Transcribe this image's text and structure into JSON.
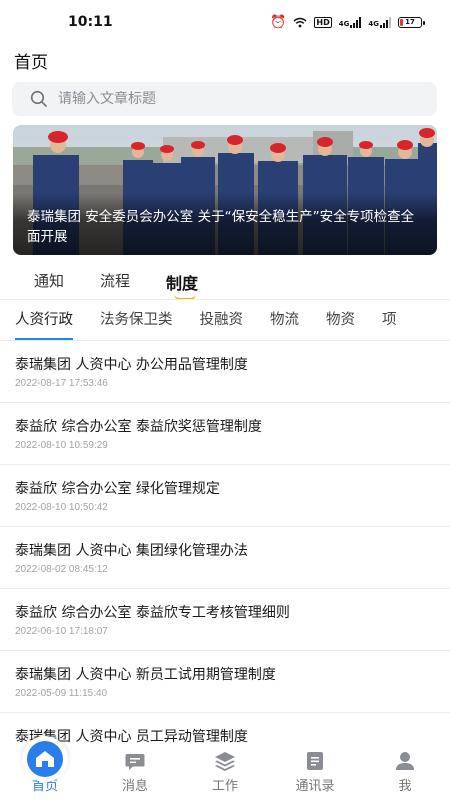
{
  "status_bar": {
    "time": "10:11",
    "battery": "17",
    "hd": "HD",
    "sig1_label": "4G",
    "sig2_label": "4G"
  },
  "header": {
    "title": "首页"
  },
  "search": {
    "placeholder": "请输入文章标题",
    "value": ""
  },
  "banner": {
    "caption": "泰瑞集团 安全委员会办公室 关于“保安全稳生产”安全专项检查全面开展"
  },
  "main_tabs": [
    {
      "label": "通知",
      "active": false
    },
    {
      "label": "流程",
      "active": false
    },
    {
      "label": "制度",
      "active": true
    }
  ],
  "sub_tabs": [
    {
      "label": "人资行政",
      "active": true
    },
    {
      "label": "法务保卫类",
      "active": false
    },
    {
      "label": "投融资",
      "active": false
    },
    {
      "label": "物流",
      "active": false
    },
    {
      "label": "物资",
      "active": false
    },
    {
      "label": "项",
      "active": false
    }
  ],
  "articles": [
    {
      "title": "泰瑞集团 人资中心 办公用品管理制度",
      "date": "2022-08-17 17:53:46"
    },
    {
      "title": "泰益欣 综合办公室 泰益欣奖惩管理制度",
      "date": "2022-08-10 10:59:29"
    },
    {
      "title": "泰益欣 综合办公室 绿化管理规定",
      "date": "2022-08-10 10:50:42"
    },
    {
      "title": "泰瑞集团 人资中心 集团绿化管理办法",
      "date": "2022-08-02 08:45:12"
    },
    {
      "title": "泰益欣 综合办公室 泰益欣专工考核管理细则",
      "date": "2022-06-10 17:18:07"
    },
    {
      "title": "泰瑞集团 人资中心 新员工试用期管理制度",
      "date": "2022-05-09 11:15:40"
    },
    {
      "title": "泰瑞集团 人资中心 员工异动管理制度",
      "date": ""
    }
  ],
  "bottom_nav": [
    {
      "label": "首页",
      "icon": "home-icon",
      "active": true
    },
    {
      "label": "消息",
      "icon": "message-icon",
      "active": false
    },
    {
      "label": "工作",
      "icon": "layers-icon",
      "active": false
    },
    {
      "label": "通讯录",
      "icon": "contacts-icon",
      "active": false
    },
    {
      "label": "我",
      "icon": "user-icon",
      "active": false
    }
  ],
  "colors": {
    "accent": "#2b7de9",
    "tab_indicator": "#1e88e5",
    "active_tab_mark": "#f5b400",
    "battery_low": "#e53935"
  }
}
